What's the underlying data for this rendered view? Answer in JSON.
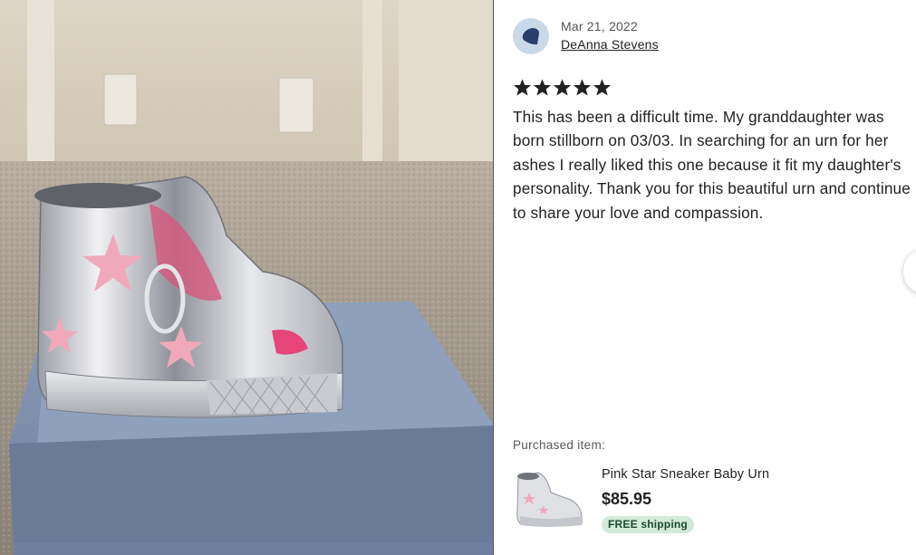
{
  "photo": {
    "description_icon": "product-photo"
  },
  "review": {
    "date": "Mar 21, 2022",
    "reviewer_name": "DeAnna Stevens",
    "rating": 5,
    "rating_max": 5,
    "text": "This has been a difficult time. My granddaughter was born stillborn on 03/03. In searching for an urn for her ashes I really liked this one because it fit my daughter's personality. Thank you for this beautiful urn and continue to share your love and compassion."
  },
  "purchased": {
    "label": "Purchased item:",
    "title": "Pink Star Sneaker Baby Urn",
    "price": "$85.95",
    "shipping_badge": "FREE shipping"
  },
  "colors": {
    "star": "#222222",
    "avatar_bg": "#c9d9ea",
    "avatar_fg": "#2a3f6e",
    "badge_bg": "#d4e9d7"
  }
}
